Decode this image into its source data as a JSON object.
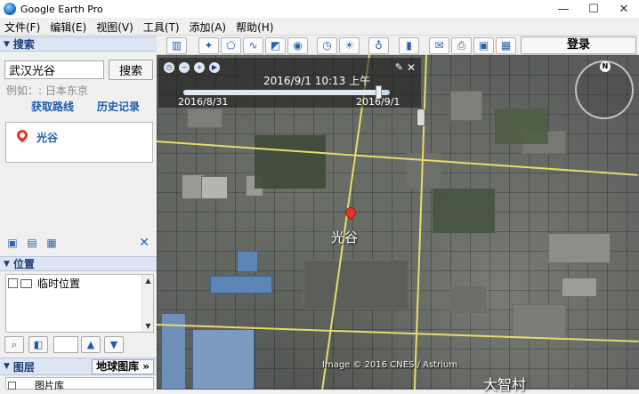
{
  "window": {
    "title": "Google Earth Pro",
    "controls": [
      "—",
      "☐",
      "✕"
    ]
  },
  "menu": [
    "文件(F)",
    "编辑(E)",
    "视图(V)",
    "工具(T)",
    "添加(A)",
    "帮助(H)"
  ],
  "search_panel": {
    "header": "搜索",
    "input_value": "武汉光谷",
    "search_button": "搜索",
    "example": "例如：: 日本东京",
    "directions_link": "获取路线",
    "history_link": "历史记录",
    "result": "光谷"
  },
  "places_panel": {
    "header": "位置",
    "temp_places": "临时位置"
  },
  "layers_panel": {
    "header": "图层",
    "gallery_button": "地球图库 »",
    "first_layer": "图片库"
  },
  "toolbar": {
    "login": "登录"
  },
  "time_slider": {
    "current": "2016/9/1   10:13 上午",
    "start": "2016/8/31",
    "end": "2016/9/1",
    "position": 0.95
  },
  "map": {
    "marker_label": "光谷",
    "place_label": "大智村",
    "attribution": "Image © 2016 CNES / Astrium",
    "compass_north": "N"
  }
}
